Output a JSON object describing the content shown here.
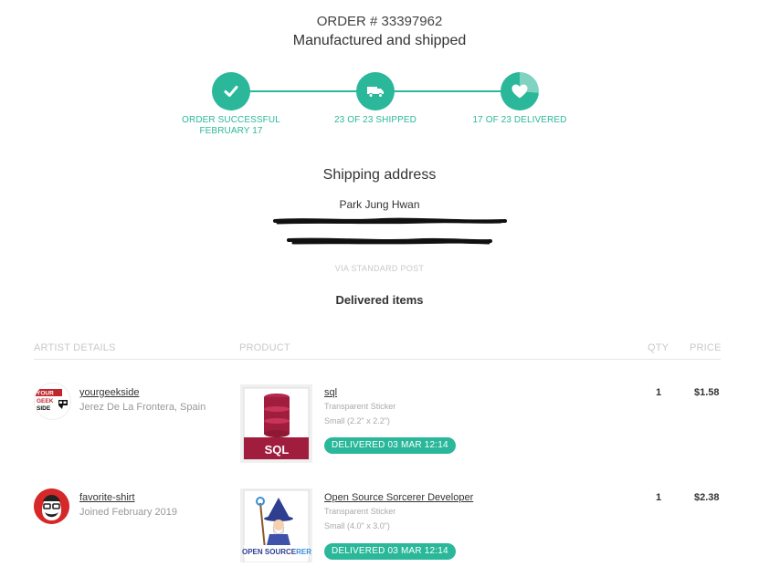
{
  "order": {
    "number_label": "ORDER # 33397962",
    "status_title": "Manufactured and shipped"
  },
  "progress": {
    "accent_color": "#2bb89a",
    "steps": [
      {
        "icon": "check-icon",
        "label_line1": "ORDER SUCCESSFUL",
        "label_line2": "FEBRUARY 17"
      },
      {
        "icon": "truck-icon",
        "label_line1": "23 OF 23 SHIPPED",
        "label_line2": ""
      },
      {
        "icon": "heart-icon",
        "label_line1": "17 OF 23 DELIVERED",
        "label_line2": ""
      }
    ]
  },
  "shipping": {
    "heading": "Shipping address",
    "recipient_name": "Park Jung Hwan",
    "method": "VIA STANDARD POST"
  },
  "delivered": {
    "heading": "Delivered items",
    "columns": {
      "artist": "ARTIST DETAILS",
      "product": "PRODUCT",
      "qty": "QTY",
      "price": "PRICE"
    },
    "items": [
      {
        "artist_name": "yourgeekside",
        "artist_meta": "Jerez De La Frontera, Spain",
        "artist_avatar_text": [
          "YOUR",
          "GEEK",
          "SIDE"
        ],
        "product_title": "sql",
        "product_type": "Transparent Sticker",
        "product_size": "Small (2.2\" x 2.2\")",
        "thumb_text": "SQL",
        "status": "DELIVERED 03 MAR 12:14",
        "qty": "1",
        "price": "$1.58"
      },
      {
        "artist_name": "favorite-shirt",
        "artist_meta": "Joined February 2019",
        "product_title": "Open Source Sorcerer Developer",
        "product_type": "Transparent Sticker",
        "product_size": "Small (4.0\" x 3.0\")",
        "thumb_text_1": "OPEN SOURCE",
        "thumb_text_2": "RER",
        "status": "DELIVERED 03 MAR 12:14",
        "qty": "1",
        "price": "$2.38"
      }
    ]
  }
}
